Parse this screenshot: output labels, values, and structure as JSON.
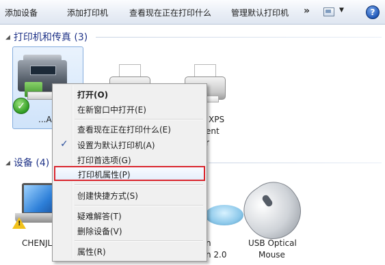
{
  "toolbar": {
    "buttons": [
      "添加设备",
      "添加打印机",
      "查看现在正在打印什么",
      "管理默认打印机"
    ],
    "more": "»",
    "help": "?"
  },
  "groups": {
    "printers": {
      "title": "打印机和传真 (3)"
    },
    "devices": {
      "title": "设备 (4)"
    }
  },
  "printers": [
    {
      "label": "...AL",
      "status": "default",
      "selected": true
    },
    {
      "label": ""
    },
    {
      "label": "XPS",
      "label2": "ent",
      "label3": "r"
    }
  ],
  "devices": [
    {
      "label": "CHENJL",
      "warning": true
    },
    {
      "label": "n",
      "label2": "n 2.0"
    },
    {
      "label": "USB Optical",
      "label2": "Mouse"
    }
  ],
  "context_menu": {
    "items": [
      {
        "label": "打开(O)",
        "bold": true
      },
      {
        "label": "在新窗口中打开(E)"
      },
      {
        "label": "查看现在正在打印什么(E)"
      },
      {
        "label": "设置为默认打印机(A)",
        "checked": true
      },
      {
        "label": "打印首选项(G)"
      },
      {
        "label": "打印机属性(P)",
        "highlighted": true
      },
      {
        "label": "创建快捷方式(S)"
      },
      {
        "label": "疑难解答(T)"
      },
      {
        "label": "删除设备(V)"
      },
      {
        "label": "属性(R)"
      }
    ],
    "check_mark": "✓"
  },
  "colors": {
    "group_header": "#1e3287",
    "highlight_border": "#d9242c",
    "selection_fill": "#cfe3fa"
  }
}
